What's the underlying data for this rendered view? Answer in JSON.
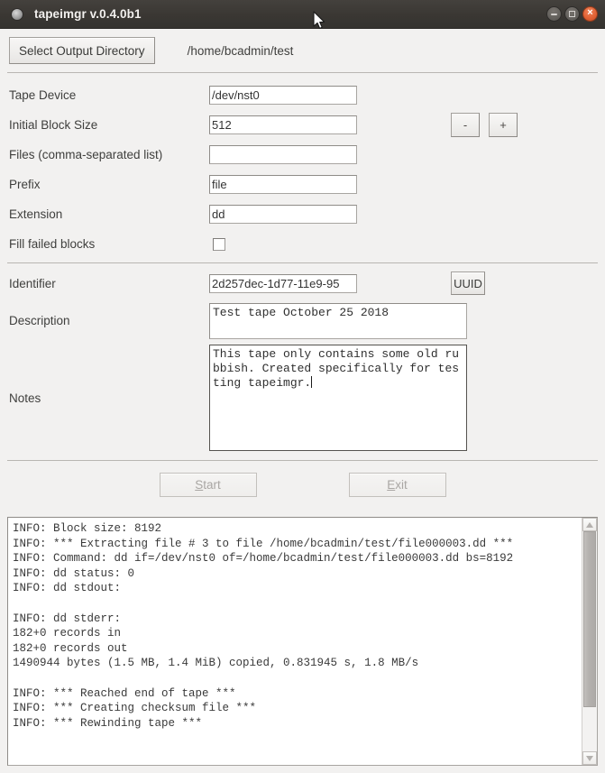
{
  "window": {
    "title": "tapeimgr v.0.4.0b1",
    "icon": "app-circle-icon",
    "controls": {
      "minimize": "–",
      "maximize": "□",
      "close": "×"
    }
  },
  "toolbar": {
    "select_dir_label": "Select Output Directory",
    "output_dir": "/home/bcadmin/test"
  },
  "form": {
    "fields": [
      {
        "label": "Tape Device",
        "value": "/dev/nst0",
        "placeholder": ""
      },
      {
        "label": "Initial Block Size",
        "value": "512",
        "placeholder": ""
      },
      {
        "label": "Files (comma-separated list)",
        "value": "",
        "placeholder": ""
      },
      {
        "label": "Prefix",
        "value": "file",
        "placeholder": ""
      },
      {
        "label": "Extension",
        "value": "dd",
        "placeholder": ""
      }
    ],
    "checkbox": {
      "label": "Fill failed blocks",
      "checked": false
    },
    "spinner": {
      "minus_label": "-",
      "plus_label": "+"
    }
  },
  "meta": {
    "identifier": {
      "label": "Identifier",
      "value": "2d257dec-1d77-11e9-95",
      "button_label": "UUID"
    },
    "description": {
      "label": "Description",
      "value": "Test tape October 25 2018"
    },
    "notes": {
      "label": "Notes",
      "value": "This tape only contains some old rubbish. Created specifically for testing tapeimgr."
    }
  },
  "actions": {
    "start": {
      "mnemonic": "S",
      "rest": "tart",
      "enabled": false
    },
    "exit": {
      "mnemonic": "E",
      "rest": "xit",
      "enabled": false
    }
  },
  "log": {
    "text": "INFO: Block size: 8192\nINFO: *** Extracting file # 3 to file /home/bcadmin/test/file000003.dd ***\nINFO: Command: dd if=/dev/nst0 of=/home/bcadmin/test/file000003.dd bs=8192\nINFO: dd status: 0\nINFO: dd stdout:\n\nINFO: dd stderr:\n182+0 records in\n182+0 records out\n1490944 bytes (1.5 MB, 1.4 MiB) copied, 0.831945 s, 1.8 MB/s\n\nINFO: *** Reached end of tape ***\nINFO: *** Creating checksum file ***\nINFO: *** Rewinding tape ***",
    "scrollbar": {
      "up_icon": "triangle-up-icon",
      "down_icon": "triangle-down-icon",
      "thumb_fraction": 0.8
    }
  },
  "colors": {
    "titlebar": "#3a3733",
    "close_button": "#e06033",
    "window_background": "#f2f1f0",
    "field_background": "#ffffff",
    "text": "#3f3f3d"
  }
}
